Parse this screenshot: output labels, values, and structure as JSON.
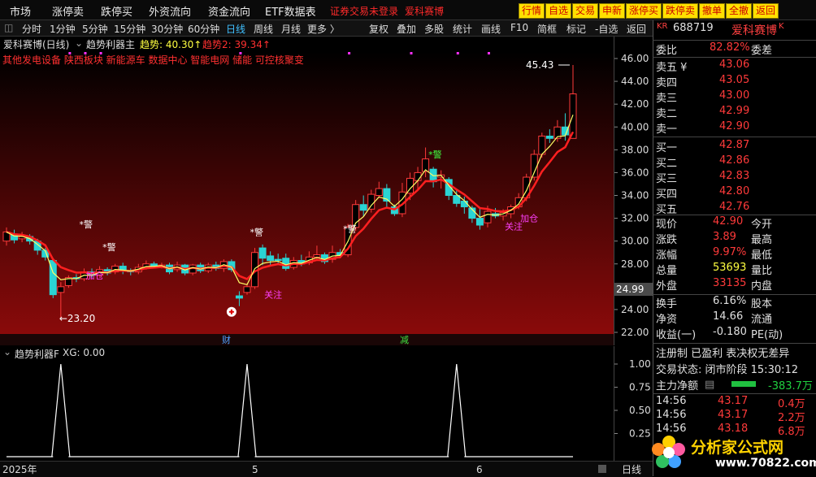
{
  "topbar": {
    "menu": [
      "市场",
      "涨停卖",
      "跌停买",
      "外资流向",
      "资金流向",
      "ETF数据表"
    ],
    "warning": "证券交易未登录",
    "warning2": "爱科赛博",
    "buttons": [
      "行情",
      "自选",
      "交易",
      "申新",
      "涨停买",
      "跌停卖",
      "撤单",
      "全撤",
      "返回"
    ]
  },
  "toolbar": {
    "periods": [
      "分时",
      "1分钟",
      "5分钟",
      "15分钟",
      "30分钟",
      "60分钟",
      "日线",
      "周线",
      "月线",
      "更多 〉"
    ],
    "active_period": "日线",
    "tools": [
      "复权",
      "叠加",
      "多股",
      "统计",
      "画线",
      "F10",
      "简框",
      "标记",
      "-自选",
      "返回"
    ]
  },
  "chart_header": {
    "name": "爱科赛博(日线)",
    "indicator": "趋势利器主",
    "trend1": "趋势: 40.30↑",
    "trend2": "趋势2: 39.34↑"
  },
  "concepts": "其他发电设备  陕西板块  新能源车  数据中心  智能电网  储能  可控核聚变",
  "annotations": {
    "high": "45.43",
    "low": "23.20",
    "warn": "*警",
    "attention": "关注",
    "add": "加仓",
    "cai": "财",
    "jian": "减"
  },
  "colors": {
    "up": "#ff3a3a",
    "down": "#2ad4d4",
    "ma_fast": "#ffff66",
    "ma_slow": "#ff2020"
  },
  "chart_data": {
    "type": "candlestick",
    "ylim": [
      22,
      46
    ],
    "y_ticks": [
      "46.00",
      "44.00",
      "42.00",
      "40.00",
      "38.00",
      "36.00",
      "34.00",
      "32.00",
      "30.00",
      "28.00",
      "26.00",
      "24.00",
      "22.00"
    ],
    "crosshair_price": "24.99",
    "candles": [
      [
        30.0,
        30.8,
        29.6,
        31.2
      ],
      [
        30.6,
        30.1,
        29.8,
        31.0
      ],
      [
        30.2,
        30.4,
        29.9,
        30.8
      ],
      [
        30.4,
        30.0,
        29.7,
        30.6
      ],
      [
        30.0,
        29.2,
        28.8,
        30.2
      ],
      [
        29.2,
        28.6,
        28.3,
        29.4
      ],
      [
        28.3,
        25.3,
        25.0,
        28.5
      ],
      [
        25.5,
        26.0,
        23.2,
        26.4
      ],
      [
        26.1,
        26.8,
        25.9,
        27.0
      ],
      [
        26.8,
        26.7,
        26.4,
        27.1
      ],
      [
        26.7,
        27.3,
        26.5,
        27.6
      ],
      [
        27.3,
        27.0,
        26.8,
        27.6
      ],
      [
        27.0,
        27.5,
        26.9,
        27.8
      ],
      [
        27.5,
        27.2,
        27.0,
        27.7
      ],
      [
        27.3,
        27.8,
        27.1,
        28.0
      ],
      [
        27.8,
        27.4,
        27.1,
        28.1
      ],
      [
        27.4,
        27.3,
        27.0,
        27.6
      ],
      [
        27.3,
        27.7,
        27.1,
        28.0
      ],
      [
        27.7,
        28.0,
        27.5,
        28.3
      ],
      [
        28.0,
        27.8,
        27.6,
        28.2
      ],
      [
        27.8,
        27.9,
        27.6,
        28.1
      ],
      [
        27.9,
        27.3,
        27.1,
        28.1
      ],
      [
        27.5,
        27.9,
        27.3,
        28.2
      ],
      [
        27.9,
        27.2,
        27.0,
        28.0
      ],
      [
        27.2,
        27.9,
        27.0,
        28.0
      ],
      [
        27.9,
        27.4,
        27.2,
        28.1
      ],
      [
        27.4,
        27.9,
        27.2,
        28.1
      ],
      [
        27.9,
        27.6,
        27.4,
        28.2
      ],
      [
        27.6,
        28.2,
        27.3,
        28.4
      ],
      [
        28.2,
        27.5,
        27.3,
        28.4
      ],
      [
        25.2,
        25.0,
        24.3,
        25.6
      ],
      [
        25.5,
        26.0,
        25.3,
        26.3
      ],
      [
        26.0,
        29.0,
        25.8,
        29.4
      ],
      [
        29.4,
        28.5,
        27.9,
        29.7
      ],
      [
        28.7,
        28.3,
        27.9,
        29.1
      ],
      [
        28.4,
        28.3,
        28.0,
        28.9
      ],
      [
        28.5,
        27.6,
        27.4,
        28.9
      ],
      [
        27.7,
        28.3,
        27.5,
        28.6
      ],
      [
        28.3,
        28.0,
        27.8,
        28.8
      ],
      [
        28.1,
        28.6,
        27.9,
        29.1
      ],
      [
        28.6,
        28.8,
        28.4,
        29.6
      ],
      [
        28.8,
        28.2,
        28.0,
        29.0
      ],
      [
        28.4,
        29.0,
        28.1,
        29.6
      ],
      [
        29.0,
        28.8,
        28.5,
        29.3
      ],
      [
        28.8,
        31.2,
        28.6,
        31.5
      ],
      [
        31.2,
        33.2,
        30.9,
        33.6
      ],
      [
        33.2,
        32.7,
        32.2,
        34.0
      ],
      [
        32.8,
        34.1,
        32.5,
        34.5
      ],
      [
        34.0,
        34.6,
        33.8,
        35.2
      ],
      [
        34.6,
        33.5,
        33.0,
        35.0
      ],
      [
        33.0,
        32.4,
        32.2,
        33.2
      ],
      [
        32.4,
        34.3,
        32.1,
        35.1
      ],
      [
        34.2,
        35.5,
        33.6,
        36.0
      ],
      [
        35.3,
        36.0,
        34.5,
        36.5
      ],
      [
        36.1,
        37.2,
        35.6,
        38.2
      ],
      [
        36.3,
        35.2,
        34.7,
        36.5
      ],
      [
        35.6,
        35.8,
        34.6,
        36.2
      ],
      [
        35.4,
        34.0,
        33.6,
        35.6
      ],
      [
        34.0,
        33.3,
        33.0,
        34.6
      ],
      [
        33.5,
        33.0,
        32.4,
        33.9
      ],
      [
        32.9,
        32.0,
        31.6,
        33.1
      ],
      [
        32.0,
        31.4,
        31.0,
        32.8
      ],
      [
        31.6,
        32.6,
        31.2,
        33.1
      ],
      [
        32.4,
        32.2,
        32.0,
        32.9
      ],
      [
        32.2,
        32.5,
        31.8,
        32.8
      ],
      [
        32.4,
        33.0,
        32.0,
        33.2
      ],
      [
        33.0,
        33.8,
        32.8,
        34.2
      ],
      [
        33.8,
        35.6,
        33.5,
        35.9
      ],
      [
        35.6,
        37.6,
        35.3,
        38.0
      ],
      [
        37.6,
        39.2,
        37.3,
        39.5
      ],
      [
        39.2,
        39.0,
        38.6,
        39.8
      ],
      [
        39.0,
        40.0,
        38.7,
        40.6
      ],
      [
        40.0,
        39.3,
        38.8,
        41.2
      ],
      [
        39.0,
        42.9,
        39.0,
        45.43
      ]
    ],
    "ind_yticks": [
      "1.00",
      "0.75",
      "0.50",
      "0.25"
    ],
    "ind_label": "趋势利器F",
    "ind_value": "XG: 0.00",
    "ind_spikes": [
      7,
      31,
      58
    ],
    "x_labels": [
      "2025年",
      "5",
      "6"
    ],
    "x_right": "日线"
  },
  "panel": {
    "code": "688719",
    "name": "爱科赛博",
    "wei_bi_label": "委比",
    "wei_bi": "82.82%",
    "wei_cha_label": "委差",
    "sell": [
      [
        "卖五 ¥",
        "43.06"
      ],
      [
        "卖四",
        "43.05"
      ],
      [
        "卖三",
        "43.00"
      ],
      [
        "卖二",
        "42.99"
      ],
      [
        "卖一",
        "42.90"
      ]
    ],
    "buy": [
      [
        "买一",
        "42.87"
      ],
      [
        "买二",
        "42.86"
      ],
      [
        "买三",
        "42.83"
      ],
      [
        "买四",
        "42.80"
      ],
      [
        "买五",
        "42.76"
      ]
    ],
    "stats": [
      [
        "现价",
        "42.90",
        "今开"
      ],
      [
        "涨跌",
        "3.89",
        "最高"
      ],
      [
        "涨幅",
        "9.97%",
        "最低"
      ],
      [
        "总量",
        "53693",
        "量比"
      ],
      [
        "外盘",
        "33135",
        "内盘"
      ]
    ],
    "stats2": [
      [
        "换手",
        "6.16%",
        "股本"
      ],
      [
        "净资",
        "14.66",
        "流通"
      ],
      [
        "收益(一)",
        "-0.180",
        "PE(动)"
      ]
    ],
    "flags": "注册制  已盈利  表决权无差异",
    "status": "交易状态: 闭市阶段  15:30:12",
    "net_flow_label": "主力净额",
    "net_flow": "-383.7万",
    "ticks": [
      [
        "14:56",
        "43.17",
        "0.4万"
      ],
      [
        "14:56",
        "43.17",
        "2.2万"
      ],
      [
        "14:56",
        "43.18",
        "6.8万"
      ]
    ],
    "watermark": "分析家公式网",
    "watermark_url": "www.70822.com"
  }
}
